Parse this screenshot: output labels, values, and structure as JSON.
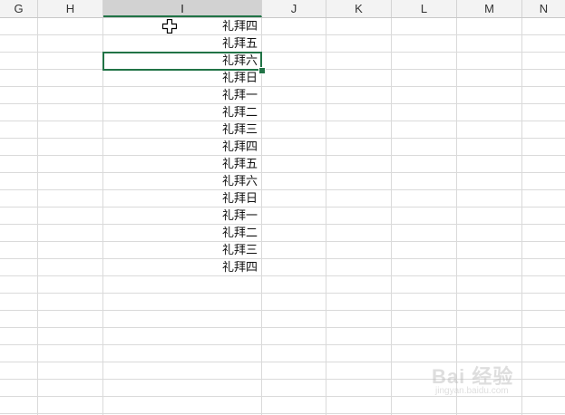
{
  "columns": [
    {
      "label": "G",
      "selected": false
    },
    {
      "label": "H",
      "selected": false
    },
    {
      "label": "I",
      "selected": true
    },
    {
      "label": "J",
      "selected": false
    },
    {
      "label": "K",
      "selected": false
    },
    {
      "label": "L",
      "selected": false
    },
    {
      "label": "M",
      "selected": false
    },
    {
      "label": "N",
      "selected": false
    }
  ],
  "cells": [
    "礼拜四",
    "礼拜五",
    "礼拜六",
    "礼拜日",
    "礼拜一",
    "礼拜二",
    "礼拜三",
    "礼拜四",
    "礼拜五",
    "礼拜六",
    "礼拜日",
    "礼拜一",
    "礼拜二",
    "礼拜三",
    "礼拜四"
  ],
  "active_cell_value": "礼拜六",
  "cursor_icon": "fill-cross-cursor-icon",
  "watermark": {
    "main": "Bai 经验",
    "sub": "jingyan.baidu.com"
  },
  "colors": {
    "accent": "#217346",
    "grid": "#dadada",
    "header_bg": "#f3f3f3",
    "header_selected_bg": "#d2d2d2"
  }
}
